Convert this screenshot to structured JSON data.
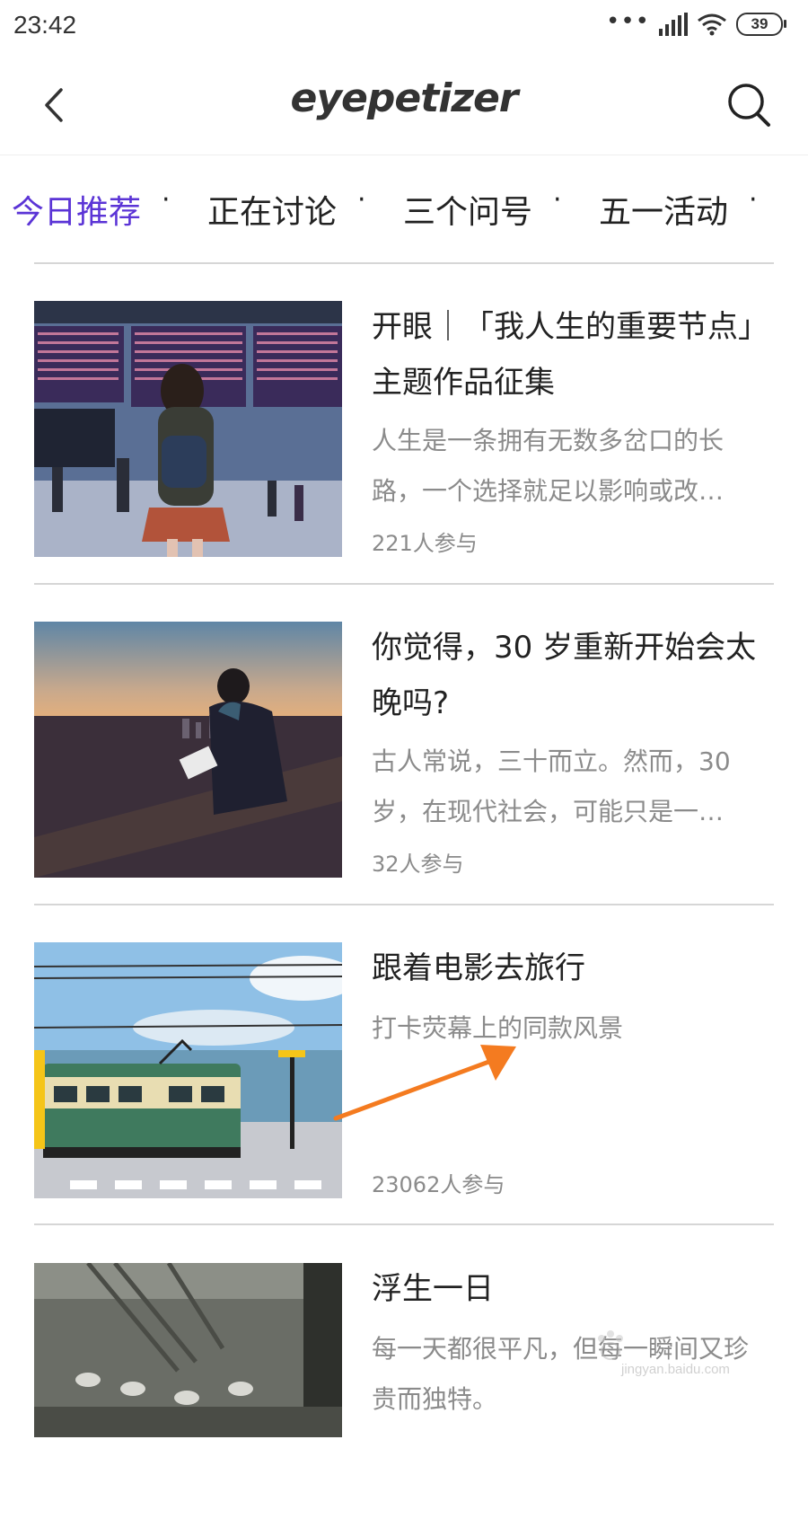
{
  "status_bar": {
    "time": "23:42",
    "battery": "39",
    "dots": "•••"
  },
  "header": {
    "logo": "eyepetizer"
  },
  "tabs": [
    {
      "label": "今日推荐",
      "active": true
    },
    {
      "label": "正在讨论",
      "active": false
    },
    {
      "label": "三个问号",
      "active": false
    },
    {
      "label": "五一活动",
      "active": false
    }
  ],
  "tab_separator": "·",
  "items": [
    {
      "title": "开眼｜「我人生的重要节点」主题作品征集",
      "desc": "人生是一条拥有无数多岔口的长路，一个选择就足以影响或改…",
      "count": "221人参与"
    },
    {
      "title": "你觉得，30 岁重新开始会太晚吗?",
      "desc": "古人常说，三十而立。然而，30 岁，在现代社会，可能只是一…",
      "count": "32人参与"
    },
    {
      "title": "跟着电影去旅行",
      "desc": "打卡荧幕上的同款风景",
      "count": "23062人参与"
    },
    {
      "title": "浮生一日",
      "desc": "每一天都很平凡，但每一瞬间又珍贵而独特。",
      "count": ""
    }
  ],
  "annotation_arrow_color": "#f47b20",
  "accent_color": "#5b34d6",
  "watermark": {
    "text": "jingyan.baidu.com"
  }
}
